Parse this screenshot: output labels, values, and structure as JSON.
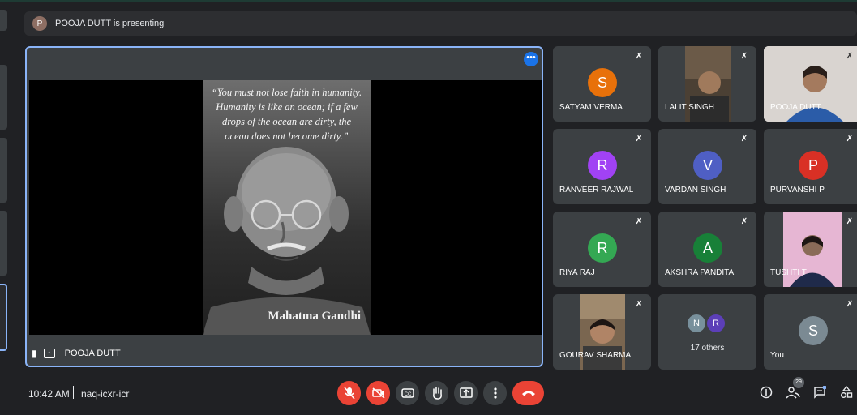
{
  "presenting_banner": {
    "avatar_letter": "P",
    "text": "POOJA DUTT is presenting"
  },
  "main_tile": {
    "quote": "“You must not lose faith in humanity. Humanity is like an ocean; if a few drops of the ocean are dirty, the ocean does not become dirty.”",
    "caption": "Mahatma Gandhi",
    "presenter_name": "POOJA DUTT",
    "more_label": "•••"
  },
  "participants": [
    {
      "name": "SATYAM VERMA",
      "letter": "S",
      "color": "#e8710a",
      "type": "avatar"
    },
    {
      "name": "LALIT SINGH",
      "letter": "",
      "color": "",
      "type": "camera"
    },
    {
      "name": "POOJA DUTT",
      "letter": "",
      "color": "",
      "type": "camera"
    },
    {
      "name": "RANVEER RAJWAL",
      "letter": "R",
      "color": "#a142f4",
      "type": "avatar"
    },
    {
      "name": "VARDAN SINGH",
      "letter": "V",
      "color": "#4f5fc4",
      "type": "avatar"
    },
    {
      "name": "PURVANSHI P",
      "letter": "P",
      "color": "#d93025",
      "type": "avatar"
    },
    {
      "name": "RIYA RAJ",
      "letter": "R",
      "color": "#34a853",
      "type": "avatar"
    },
    {
      "name": "AKSHRA PANDITA",
      "letter": "A",
      "color": "#188038",
      "type": "avatar"
    },
    {
      "name": "TUSHTI T",
      "letter": "",
      "color": "",
      "type": "camera"
    },
    {
      "name": "GOURAV SHARMA",
      "letter": "",
      "color": "",
      "type": "camera"
    },
    {
      "name": "",
      "letter": "",
      "color": "",
      "type": "others",
      "others_label": "17 others",
      "mini_letters": [
        "N",
        "R"
      ]
    },
    {
      "name": "You",
      "letter": "S",
      "color": "#7b8a93",
      "type": "avatar"
    }
  ],
  "bottom_bar": {
    "time": "10:42 AM",
    "separator": "|",
    "meeting_code": "naq-icxr-icr",
    "participant_count": "29"
  },
  "icons": {
    "mic_off": "mic-off-icon",
    "cam_off": "camera-off-icon",
    "cc": "captions-icon",
    "hand": "raise-hand-icon",
    "present": "present-icon",
    "more": "more-vert-icon",
    "end": "end-call-icon",
    "info": "info-icon",
    "people": "people-icon",
    "chat": "chat-icon",
    "activities": "activities-icon"
  }
}
